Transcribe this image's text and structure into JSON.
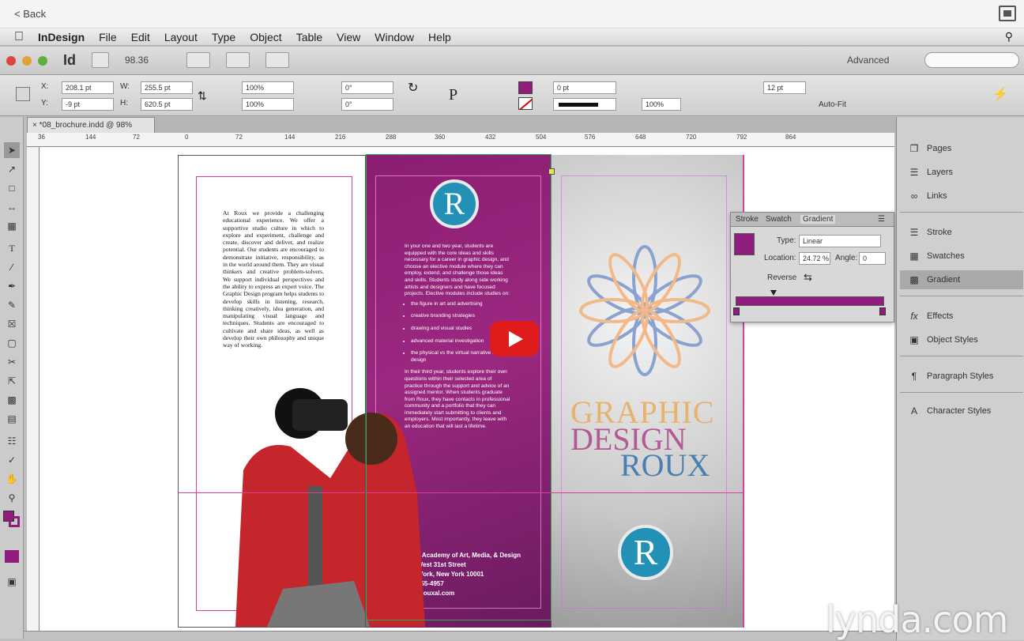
{
  "browser": {
    "back_label": "< Back"
  },
  "menu": {
    "app_name": "InDesign",
    "items": [
      "File",
      "Edit",
      "Layout",
      "Type",
      "Object",
      "Table",
      "View",
      "Window",
      "Help"
    ]
  },
  "appbar": {
    "logo": "Id",
    "zoom": "98.36",
    "workspace": "Advanced"
  },
  "control": {
    "x_label": "X:",
    "x_value": "208.1 pt",
    "y_label": "Y:",
    "y_value": "-9 pt",
    "w_label": "W:",
    "w_value": "255.5 pt",
    "h_label": "H:",
    "h_value": "620.5 pt",
    "scale_x": "100%",
    "scale_y": "100%",
    "angle": "0°",
    "shear": "0°",
    "stroke_weight": "0 pt",
    "opacity": "100%",
    "gap": "12 pt",
    "autofit_label": "Auto-Fit"
  },
  "document": {
    "tab_title": "*08_brochure.indd @ 98%"
  },
  "ruler": {
    "ticks": [
      "36",
      "144",
      "72",
      "0",
      "72",
      "144",
      "216",
      "288",
      "360",
      "432",
      "504",
      "576",
      "648",
      "720",
      "792",
      "864"
    ]
  },
  "brochure": {
    "left_body": "At Roux we provide a challenging educational experience. We offer a supportive studio culture in which to explore and experiment, challenge and create, discover and deliver, and realize potential. Our students are encouraged to demonstrate initiative, responsibility, as in the world around them. They are visual thinkers and creative problem-solvers. We support individual perspectives and the ability to express an expert voice. The Graphic Design program helps students to develop skills in listening, research, thinking creatively, idea generation, and manipulating visual language and techniques. Students are encouraged to cultivate and share ideas, as well as develop their own philosophy and unique way of working.",
    "mid_intro": "In your one and two year, students are equipped with the core ideas and skills necessary for a career in graphic design, and choose an elective module where they can employ, extend, and challenge those ideas and skills. Students study along side working artists and designers and have focused projects. Elective modules include studies on:",
    "mid_bullets": [
      "the figure in art and advertising",
      "creative branding strategies",
      "drawing and visual studies",
      "advanced material investigation",
      "the physical vs the virtual narrative in design"
    ],
    "mid_outro": "In their third year, students explore their own questions within their selected area of practice through the support and advice of an assigned mentor. When students graduate from Roux, they have contacts in professional community and a portfolio that they can immediately start submitting to clients and employers. Most importantly, they leave with an education that will last a lifetime.",
    "address": [
      "Roux Academy of Art, Media, & Design",
      "826 West 31st Street",
      "New York, New York 10001",
      "212-555-4957",
      "www.rouxal.com"
    ],
    "logo_letter": "R",
    "cover_line1": "GRAPHIC",
    "cover_line2": "DESIGN",
    "cover_line3": "ROUX"
  },
  "gradient_panel": {
    "tabs": [
      "Stroke",
      "Swatch",
      "Gradient"
    ],
    "type_label": "Type:",
    "type_value": "Linear",
    "location_label": "Location:",
    "location_value": "24.72 %",
    "angle_label": "Angle:",
    "angle_value": "0",
    "reverse_label": "Reverse",
    "start_color": "#8e1d7b",
    "end_color": "#8e1d7b"
  },
  "dock": {
    "items": [
      "Pages",
      "Layers",
      "Links",
      "Stroke",
      "Swatches",
      "Gradient",
      "Effects",
      "Object Styles",
      "Paragraph Styles",
      "Character Styles"
    ]
  },
  "watermark": "lynda.com",
  "colors": {
    "brochure_purple": "#8a1e73",
    "guide_magenta": "#d9409a",
    "logo_blue": "#2391b6",
    "youtube_red": "#e01b1b"
  }
}
